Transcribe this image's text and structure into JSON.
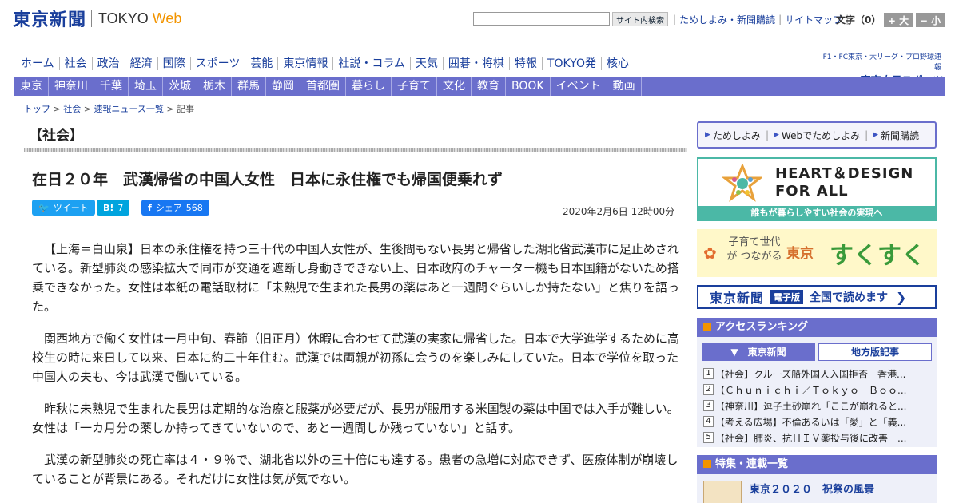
{
  "header": {
    "logo_jp": "東京新聞",
    "logo_tokyo": "TOKYO",
    "logo_web": "Web",
    "search_button": "サイト内検索",
    "util_links": [
      "ためしよみ・新聞購読",
      "サイトマップ"
    ],
    "text_size_label": "文字（0）",
    "size_up": "+ 大",
    "size_down": "− 小"
  },
  "main_nav": [
    "ホーム",
    "社会",
    "政治",
    "経済",
    "国際",
    "スポーツ",
    "芸能",
    "東京情報",
    "社説・コラム",
    "天気",
    "囲碁・将棋",
    "特報",
    "TOKYO発",
    "核心"
  ],
  "sports_link": {
    "top": "F1・FC東京・大リーグ・プロ野球速報",
    "bottom": "東京中日スポーツ"
  },
  "sub_nav": [
    "東京",
    "神奈川",
    "千葉",
    "埼玉",
    "茨城",
    "栃木",
    "群馬",
    "静岡",
    "首都圏",
    "暮らし",
    "子育て",
    "文化",
    "教育",
    "BOOK",
    "イベント",
    "動画"
  ],
  "breadcrumb": {
    "items": [
      "トップ",
      "社会",
      "速報ニュース一覧"
    ],
    "current": "記事",
    "sep": ">"
  },
  "article": {
    "section": "【社会】",
    "title": "在日２０年　武漢帰省の中国人女性　日本に永住権でも帰国便乗れず",
    "date": "2020年2月6日 12時00分",
    "share": {
      "tweet": "ツイート",
      "hatena_label": "B!",
      "hatena_count": "7",
      "fb_label": "シェア",
      "fb_count": "568"
    },
    "paragraphs": [
      "【上海＝白山泉】日本の永住権を持つ三十代の中国人女性が、生後間もない長男と帰省した湖北省武漢市に足止めされている。新型肺炎の感染拡大で同市が交通を遮断し身動きできない上、日本政府のチャーター機も日本国籍がないため搭乗できなかった。女性は本紙の電話取材に「未熟児で生まれた長男の薬はあと一週間ぐらいしか持たない」と焦りを語った。",
      "関西地方で働く女性は一月中旬、春節（旧正月）休暇に合わせて武漢の実家に帰省した。日本で大学進学するために高校生の時に来日して以来、日本に約二十年住む。武漢では両親が初孫に会うのを楽しみにしていた。日本で学位を取った中国人の夫も、今は武漢で働いている。",
      "昨秋に未熟児で生まれた長男は定期的な治療と服薬が必要だが、長男が服用する米国製の薬は中国では入手が難しい。女性は「一カ月分の薬しか持ってきていないので、あと一週間しか残っていない」と話す。",
      "武漢の新型肺炎の死亡率は４・９％で、湖北省以外の三十倍にも達する。患者の急増に対応できず、医療体制が崩壊していることが背景にある。それだけに女性は気が気でない。"
    ]
  },
  "sidebar": {
    "subscribe_links": [
      "ためしよみ",
      "Webでためしよみ",
      "新聞購読"
    ],
    "hd_banner": {
      "title_line1": "HEART＆DESIGN",
      "title_line2": "FOR ALL",
      "footer": "誰もが暮らしやすい社会の実現へ"
    },
    "suku_banner": {
      "small": "子育て世代が つながる",
      "tokyo": "東京",
      "big": "すくすく"
    },
    "denshi_banner": {
      "logo": "東京新聞",
      "tag": "電子版",
      "text": "全国で読めます",
      "chevron": "❯"
    },
    "ranking": {
      "heading": "アクセスランキング",
      "tabs": [
        "▼　東京新聞",
        "地方版記事"
      ],
      "items": [
        "【社会】クルーズ船外国人入国拒否　香港...",
        "【Ｃｈｕｎｉｃｈｉ／Ｔｏｋｙｏ　Ｂｏｏ...",
        "【神奈川】逗子土砂崩れ「ここが崩れると...",
        "【考える広場】不倫あるいは「愛」と「義...",
        "【社会】肺炎、抗ＨＩＶ薬投与後に改善　..."
      ]
    },
    "features": {
      "heading": "特集・連載一覧",
      "first_title": "東京２０２０　祝祭の風景"
    }
  },
  "colors": {
    "brand_blue": "#1a3f9c",
    "nav_purple": "#6a6ecc",
    "accent_orange": "#f29400",
    "teal": "#4bb8a6"
  }
}
